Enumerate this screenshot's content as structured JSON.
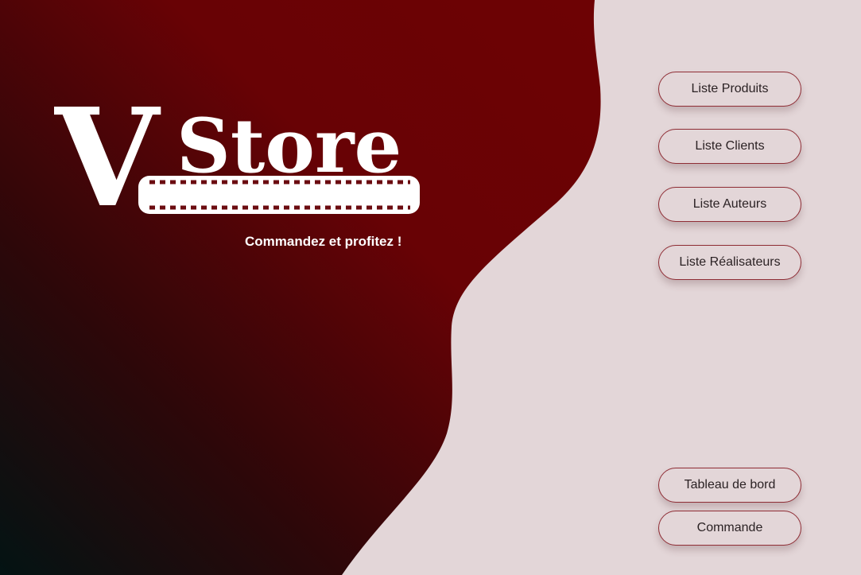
{
  "app": {
    "logo": {
      "letter": "V",
      "word": "Store"
    },
    "tagline": "Commandez et profitez !",
    "nav_buttons": [
      {
        "label": "Liste Produits"
      },
      {
        "label": "Liste Clients"
      },
      {
        "label": "Liste Auteurs"
      },
      {
        "label": "Liste Réalisateurs"
      }
    ],
    "bottom_buttons": [
      {
        "label": "Tableau de bord"
      },
      {
        "label": "Commande"
      }
    ]
  },
  "colors": {
    "panel_dark_start": "#6d0204",
    "panel_dark_end": "#031313",
    "background_light": "#e3d6d8",
    "button_border": "#8f2d35",
    "button_text": "#2b2224",
    "logo_text": "#ffffff"
  }
}
